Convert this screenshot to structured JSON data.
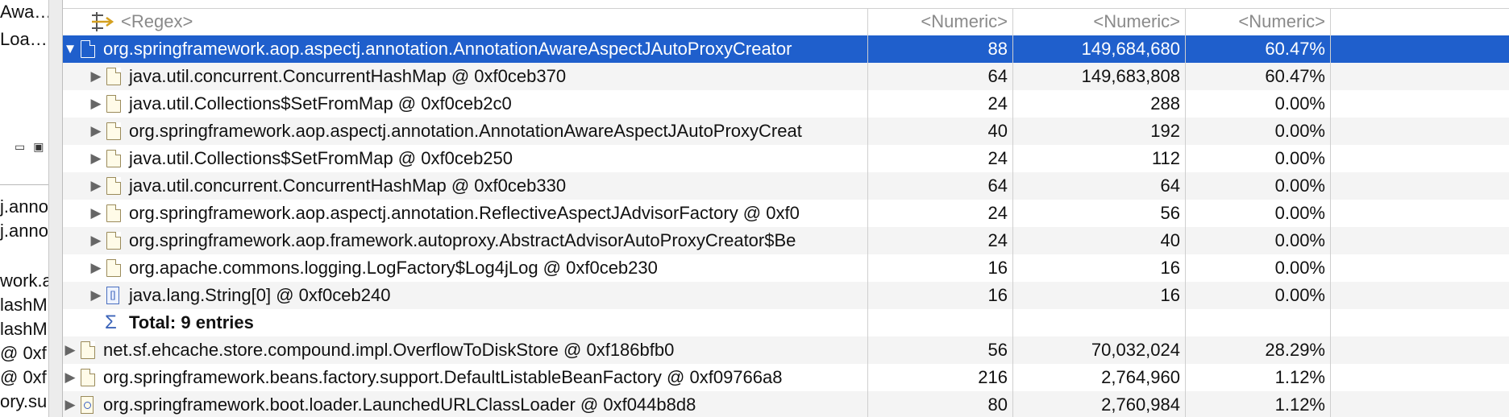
{
  "left_panel": {
    "fragments_top": [
      "Awa…",
      "Loa…"
    ],
    "fragments_bottom": [
      "j.anno",
      "j.anno",
      "work.a",
      "lashM",
      "lashM",
      "@ 0xf",
      "@ 0xf",
      "ory.su"
    ]
  },
  "columns": {
    "name_filter": "<Regex>",
    "col1_filter": "<Numeric>",
    "col2_filter": "<Numeric>",
    "col3_filter": "<Numeric>"
  },
  "rows": [
    {
      "name": "org.springframework.aop.aspectj.annotation.AnnotationAwareAspectJAutoProxyCreator",
      "c1": "88",
      "c2": "149,684,680",
      "c3": "60.47%",
      "level": 0,
      "expanded": true,
      "selected": true,
      "icon": "file-icon"
    },
    {
      "name": "java.util.concurrent.ConcurrentHashMap @ 0xf0ceb370",
      "c1": "64",
      "c2": "149,683,808",
      "c3": "60.47%",
      "level": 1,
      "icon": "file-icon"
    },
    {
      "name": "java.util.Collections$SetFromMap @ 0xf0ceb2c0",
      "c1": "24",
      "c2": "288",
      "c3": "0.00%",
      "level": 1,
      "icon": "file-icon"
    },
    {
      "name": "org.springframework.aop.aspectj.annotation.AnnotationAwareAspectJAutoProxyCreat",
      "c1": "40",
      "c2": "192",
      "c3": "0.00%",
      "level": 1,
      "icon": "file-icon"
    },
    {
      "name": "java.util.Collections$SetFromMap @ 0xf0ceb250",
      "c1": "24",
      "c2": "112",
      "c3": "0.00%",
      "level": 1,
      "icon": "file-icon"
    },
    {
      "name": "java.util.concurrent.ConcurrentHashMap @ 0xf0ceb330",
      "c1": "64",
      "c2": "64",
      "c3": "0.00%",
      "level": 1,
      "icon": "file-icon"
    },
    {
      "name": "org.springframework.aop.aspectj.annotation.ReflectiveAspectJAdvisorFactory @ 0xf0",
      "c1": "24",
      "c2": "56",
      "c3": "0.00%",
      "level": 1,
      "icon": "file-icon"
    },
    {
      "name": "org.springframework.aop.framework.autoproxy.AbstractAdvisorAutoProxyCreator$Be",
      "c1": "24",
      "c2": "40",
      "c3": "0.00%",
      "level": 1,
      "icon": "file-icon"
    },
    {
      "name": "org.apache.commons.logging.LogFactory$Log4jLog @ 0xf0ceb230",
      "c1": "16",
      "c2": "16",
      "c3": "0.00%",
      "level": 1,
      "icon": "file-icon"
    },
    {
      "name": "java.lang.String[0] @ 0xf0ceb240",
      "c1": "16",
      "c2": "16",
      "c3": "0.00%",
      "level": 1,
      "icon": "array-icon"
    },
    {
      "name": "Total: 9 entries",
      "c1": "",
      "c2": "",
      "c3": "",
      "level": 1,
      "icon": "sigma-icon",
      "total": true
    },
    {
      "name": "net.sf.ehcache.store.compound.impl.OverflowToDiskStore @ 0xf186bfb0",
      "c1": "56",
      "c2": "70,032,024",
      "c3": "28.29%",
      "level": 0,
      "icon": "file-icon"
    },
    {
      "name": "org.springframework.beans.factory.support.DefaultListableBeanFactory @ 0xf09766a8",
      "c1": "216",
      "c2": "2,764,960",
      "c3": "1.12%",
      "level": 0,
      "icon": "file-icon"
    },
    {
      "name": "org.springframework.boot.loader.LaunchedURLClassLoader @ 0xf044b8d8",
      "c1": "80",
      "c2": "2,760,984",
      "c3": "1.12%",
      "level": 0,
      "icon": "classloader-icon"
    }
  ]
}
